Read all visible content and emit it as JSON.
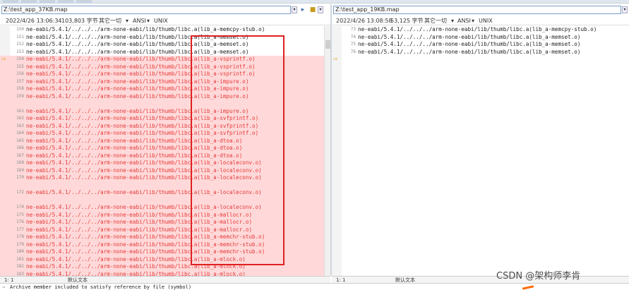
{
  "left": {
    "path": "Z:\\test_app_37KB.map",
    "info": {
      "date": "2022/4/26 13:06:34",
      "size": "103,803 字节",
      "other": "其它一切",
      "encoding": "ANSI",
      "eol": "UNIX"
    },
    "lines": [
      {
        "n": "150",
        "t": "ne-eabi/5.4.1/../../../arm-none-eabi/lib/thumb/libc.a(lib_a-memcpy-stub.o)",
        "diff": false
      },
      {
        "n": "151",
        "t": "ne-eabi/5.4.1/../../../arm-none-eabi/lib/thumb/libc.a(lib_a-memset.o)",
        "diff": false
      },
      {
        "n": "152",
        "t": "ne-eabi/5.4.1/../../../arm-none-eabi/lib/thumb/libc.a(lib_a-memset.o)",
        "diff": false
      },
      {
        "n": "153",
        "t": "ne-eabi/5.4.1/../../../arm-none-eabi/lib/thumb/libc.a(lib_a-memset.o)",
        "diff": false
      },
      {
        "n": "154",
        "t": "ne-eabi/5.4.1/../../../arm-none-eabi/lib/thumb/libc.a(lib_a-vsprintf.o)",
        "diff": true
      },
      {
        "n": "155",
        "t": "ne-eabi/5.4.1/../../../arm-none-eabi/lib/thumb/libc.a(lib_a-vsprintf.o)",
        "diff": true
      },
      {
        "n": "156",
        "t": "ne-eabi/5.4.1/../../../arm-none-eabi/lib/thumb/libc.a(lib_a-vsprintf.o)",
        "diff": true
      },
      {
        "n": "157",
        "t": "ne-eabi/5.4.1/../../../arm-none-eabi/lib/thumb/libc.a(lib_a-impure.o)",
        "diff": true
      },
      {
        "n": "158",
        "t": "ne-eabi/5.4.1/../../../arm-none-eabi/lib/thumb/libc.a(lib_a-impure.o)",
        "diff": true
      },
      {
        "n": "159",
        "t": "ne-eabi/5.4.1/../../../arm-none-eabi/lib/thumb/libc.a(lib_a-impure.o)",
        "diff": true
      },
      {
        "n": "",
        "t": "",
        "diff": true
      },
      {
        "n": "161",
        "t": "ne-eabi/5.4.1/../../../arm-none-eabi/lib/thumb/libc.a(lib_a-impure.o)",
        "diff": true
      },
      {
        "n": "162",
        "t": "ne-eabi/5.4.1/../../../arm-none-eabi/lib/thumb/libc.a(lib_a-svfprintf.o)",
        "diff": true
      },
      {
        "n": "163",
        "t": "ne-eabi/5.4.1/../../../arm-none-eabi/lib/thumb/libc.a(lib_a-svfprintf.o)",
        "diff": true
      },
      {
        "n": "164",
        "t": "ne-eabi/5.4.1/../../../arm-none-eabi/lib/thumb/libc.a(lib_a-svfprintf.o)",
        "diff": true
      },
      {
        "n": "165",
        "t": "ne-eabi/5.4.1/../../../arm-none-eabi/lib/thumb/libc.a(lib_a-dtoa.o)",
        "diff": true
      },
      {
        "n": "166",
        "t": "ne-eabi/5.4.1/../../../arm-none-eabi/lib/thumb/libc.a(lib_a-dtoa.o)",
        "diff": true
      },
      {
        "n": "167",
        "t": "ne-eabi/5.4.1/../../../arm-none-eabi/lib/thumb/libc.a(lib_a-dtoa.o)",
        "diff": true
      },
      {
        "n": "168",
        "t": "ne-eabi/5.4.1/../../../arm-none-eabi/lib/thumb/libc.a(lib_a-localeconv.o)",
        "diff": true
      },
      {
        "n": "169",
        "t": "ne-eabi/5.4.1/../../../arm-none-eabi/lib/thumb/libc.a(lib_a-localeconv.o)",
        "diff": true
      },
      {
        "n": "170",
        "t": "ne-eabi/5.4.1/../../../arm-none-eabi/lib/thumb/libc.a(lib_a-localeconv.o)",
        "diff": true
      },
      {
        "n": "",
        "t": "",
        "diff": true
      },
      {
        "n": "172",
        "t": "ne-eabi/5.4.1/../../../arm-none-eabi/lib/thumb/libc.a(lib_a-localeconv.o)",
        "diff": true
      },
      {
        "n": "",
        "t": "",
        "diff": true
      },
      {
        "n": "174",
        "t": "ne-eabi/5.4.1/../../../arm-none-eabi/lib/thumb/libc.a(lib_a-localeconv.o)",
        "diff": true
      },
      {
        "n": "175",
        "t": "ne-eabi/5.4.1/../../../arm-none-eabi/lib/thumb/libc.a(lib_a-mallocr.o)",
        "diff": true
      },
      {
        "n": "176",
        "t": "ne-eabi/5.4.1/../../../arm-none-eabi/lib/thumb/libc.a(lib_a-mallocr.o)",
        "diff": true
      },
      {
        "n": "177",
        "t": "ne-eabi/5.4.1/../../../arm-none-eabi/lib/thumb/libc.a(lib_a-mallocr.o)",
        "diff": true
      },
      {
        "n": "178",
        "t": "ne-eabi/5.4.1/../../../arm-none-eabi/lib/thumb/libc.a(lib_a-memchr-stub.o)",
        "diff": true
      },
      {
        "n": "179",
        "t": "ne-eabi/5.4.1/../../../arm-none-eabi/lib/thumb/libc.a(lib_a-memchr-stub.o)",
        "diff": true
      },
      {
        "n": "180",
        "t": "ne-eabi/5.4.1/../../../arm-none-eabi/lib/thumb/libc.a(lib_a-memchr-stub.o)",
        "diff": true
      },
      {
        "n": "181",
        "t": "ne-eabi/5.4.1/../../../arm-none-eabi/lib/thumb/libc.a(lib_a-mlock.o)",
        "diff": true
      },
      {
        "n": "182",
        "t": "ne-eabi/5.4.1/../../../arm-none-eabi/lib/thumb/libc.a(lib_a-mlock.o)",
        "diff": true
      },
      {
        "n": "183",
        "t": "ne-eabi/5.4.1/../../../arm-none-eabi/lib/thumb/libc.a(lib_a-mlock.o)",
        "diff": true
      }
    ],
    "status": {
      "pos": "1: 1",
      "default": "默认文本"
    }
  },
  "right": {
    "path": "Z:\\test_app_19KB.map",
    "info": {
      "date": "2022/4/26 13:08:58",
      "size": "53,125 字节",
      "other": "其它一切",
      "encoding": "ANSI",
      "eol": "UNIX"
    },
    "lines": [
      {
        "n": "73",
        "t": "ne-eabi/5.4.1/../../../arm-none-eabi/lib/thumb/libc.a(lib_a-memcpy-stub.o)"
      },
      {
        "n": "74",
        "t": "ne-eabi/5.4.1/../../../arm-none-eabi/lib/thumb/libc.a(lib_a-memset.o)"
      },
      {
        "n": "75",
        "t": "ne-eabi/5.4.1/../../../arm-none-eabi/lib/thumb/libc.a(lib_a-memset.o)"
      },
      {
        "n": "76",
        "t": "ne-eabi/5.4.1/../../../arm-none-eabi/lib/thumb/libc.a(lib_a-memset.o)"
      }
    ],
    "status": {
      "pos": "1: 1",
      "default": "默认文本"
    }
  },
  "bottom_line": "Archive member included to satisfy reference by file (symbol)",
  "watermark": "CSDN @架构师李肯",
  "colors": {
    "diff_bg": "#ffd9d9",
    "diff_text": "#e5393a",
    "highlight_box": "#e02020"
  }
}
